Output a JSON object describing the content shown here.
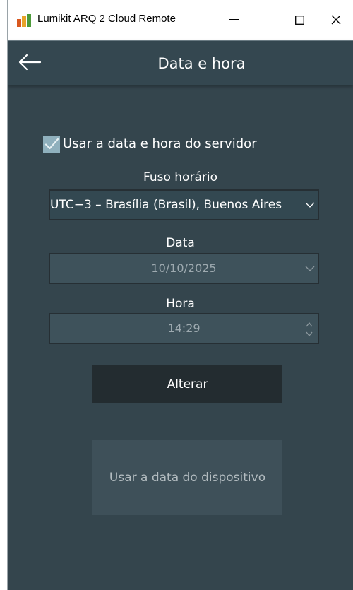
{
  "window": {
    "title": "Lumikit ARQ 2 Cloud Remote"
  },
  "header": {
    "title": "Data e hora"
  },
  "form": {
    "use_server_time_label": "Usar a data e hora do servidor",
    "use_server_time_checked": true,
    "timezone_label": "Fuso horário",
    "timezone_value": "UTC−3 – Brasília (Brasil), Buenos Aires",
    "date_label": "Data",
    "date_value": "10/10/2025",
    "time_label": "Hora",
    "time_value": "14:29",
    "apply_button": "Alterar",
    "device_date_button": "Usar a data do dispositivo"
  },
  "icons": {
    "app": "lumikit-app-icon",
    "minimize": "minimize-icon",
    "maximize": "maximize-icon",
    "close": "close-icon",
    "back": "back-arrow-icon",
    "check": "checkmark-icon",
    "chevron": "chevron-down-icon",
    "spinner": "spinner-arrows-icon"
  },
  "colors": {
    "background": "#34454d",
    "checkbox": "#8fb0bd",
    "primary_button": "#232c30",
    "disabled_button": "#3e5059"
  }
}
